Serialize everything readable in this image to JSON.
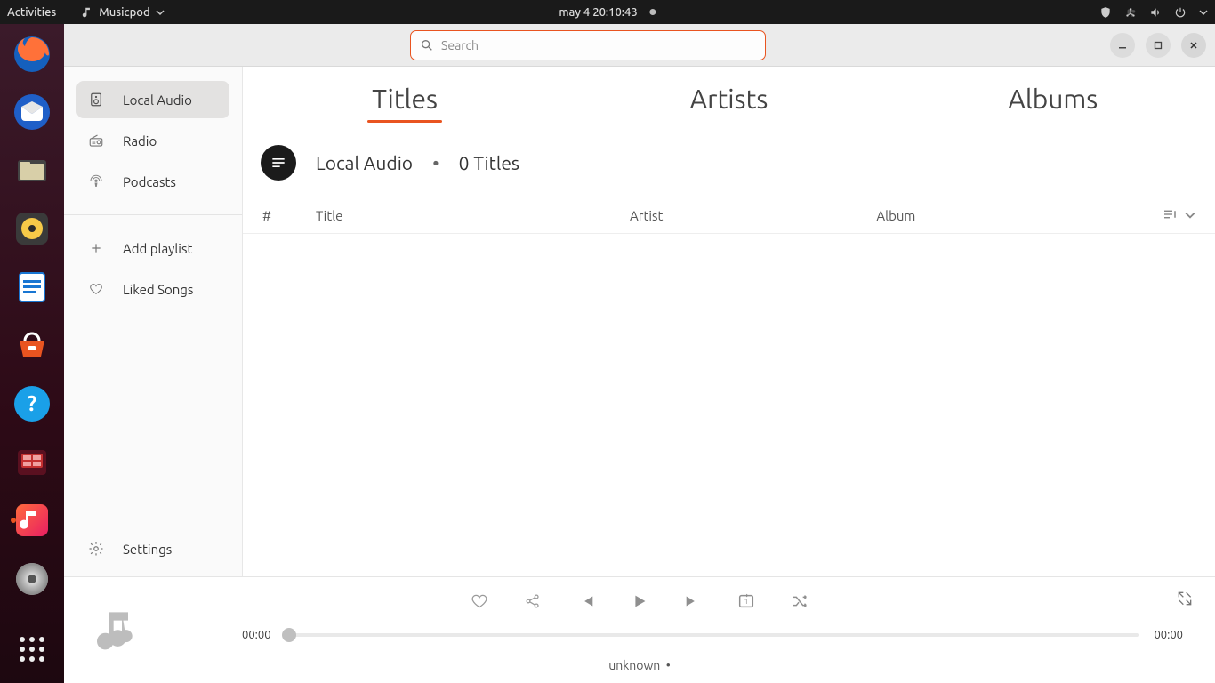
{
  "panel": {
    "activities": "Activities",
    "app_name": "Musicpod",
    "clock": "may 4  20:10:43"
  },
  "dock": {
    "items": [
      {
        "name": "firefox"
      },
      {
        "name": "thunderbird"
      },
      {
        "name": "files"
      },
      {
        "name": "rhythmbox"
      },
      {
        "name": "libreoffice-writer"
      },
      {
        "name": "software"
      },
      {
        "name": "help"
      },
      {
        "name": "screenshot"
      },
      {
        "name": "musicpod",
        "active": true
      },
      {
        "name": "disks"
      }
    ]
  },
  "header": {
    "search_placeholder": "Search"
  },
  "sidebar": {
    "items": [
      {
        "label": "Local Audio",
        "selected": true
      },
      {
        "label": "Radio"
      },
      {
        "label": "Podcasts"
      }
    ],
    "add_playlist": "Add playlist",
    "liked_songs": "Liked Songs",
    "settings": "Settings"
  },
  "tabs": {
    "items": [
      {
        "label": "Titles",
        "active": true
      },
      {
        "label": "Artists"
      },
      {
        "label": "Albums"
      }
    ]
  },
  "section": {
    "title": "Local Audio",
    "separator": "•",
    "subtitle": "0 Titles"
  },
  "columns": {
    "hash": "#",
    "title": "Title",
    "artist": "Artist",
    "album": "Album"
  },
  "player": {
    "elapsed": "00:00",
    "total": "00:00",
    "now_playing": "unknown",
    "separator": "•"
  }
}
